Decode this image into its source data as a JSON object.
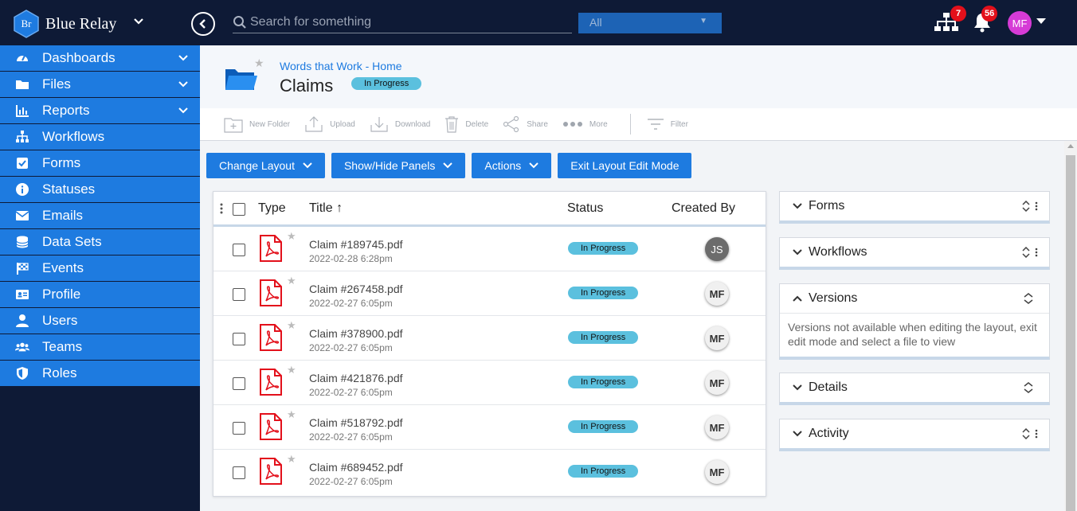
{
  "app": {
    "brand": "Blue Relay",
    "logo_text": "Br"
  },
  "topbar": {
    "search_placeholder": "Search for something",
    "scope_value": "All",
    "workflow_badge": "7",
    "notification_badge": "56",
    "user_initials": "MF",
    "colors": {
      "bg": "#0e1a36",
      "accent": "#1e7be0",
      "badge": "#e3101b",
      "avatar": "#d63bd6"
    }
  },
  "sidebar": {
    "items": [
      {
        "label": "Dashboards",
        "icon": "dashboard-icon",
        "expandable": true
      },
      {
        "label": "Files",
        "icon": "folder-icon",
        "expandable": true
      },
      {
        "label": "Reports",
        "icon": "bar-chart-icon",
        "expandable": true
      },
      {
        "label": "Workflows",
        "icon": "sitemap-icon",
        "expandable": false
      },
      {
        "label": "Forms",
        "icon": "checkbox-icon",
        "expandable": false
      },
      {
        "label": "Statuses",
        "icon": "info-icon",
        "expandable": false
      },
      {
        "label": "Emails",
        "icon": "envelope-icon",
        "expandable": false
      },
      {
        "label": "Data Sets",
        "icon": "database-icon",
        "expandable": false
      },
      {
        "label": "Events",
        "icon": "flag-checkered-icon",
        "expandable": false
      },
      {
        "label": "Profile",
        "icon": "id-card-icon",
        "expandable": false
      },
      {
        "label": "Users",
        "icon": "user-icon",
        "expandable": false
      },
      {
        "label": "Teams",
        "icon": "users-icon",
        "expandable": false
      },
      {
        "label": "Roles",
        "icon": "shield-icon",
        "expandable": false
      }
    ]
  },
  "header": {
    "breadcrumb": "Words that Work - Home",
    "title": "Claims",
    "status": "In Progress"
  },
  "toolbar": {
    "new_folder": "New Folder",
    "upload": "Upload",
    "download": "Download",
    "delete": "Delete",
    "share": "Share",
    "more": "More",
    "filter": "Filter"
  },
  "layout_buttons": {
    "change_layout": "Change Layout",
    "show_hide_panels": "Show/Hide Panels",
    "actions": "Actions",
    "exit_layout_edit": "Exit Layout Edit Mode"
  },
  "table": {
    "columns": {
      "type": "Type",
      "title": "Title",
      "sort_indicator": "↑",
      "status": "Status",
      "created_by": "Created By"
    },
    "rows": [
      {
        "name": "Claim #189745.pdf",
        "date": "2022-02-28 6:28pm",
        "status": "In Progress",
        "created_by": "JS"
      },
      {
        "name": "Claim #267458.pdf",
        "date": "2022-02-27 6:05pm",
        "status": "In Progress",
        "created_by": "MF"
      },
      {
        "name": "Claim #378900.pdf",
        "date": "2022-02-27 6:05pm",
        "status": "In Progress",
        "created_by": "MF"
      },
      {
        "name": "Claim #421876.pdf",
        "date": "2022-02-27 6:05pm",
        "status": "In Progress",
        "created_by": "MF"
      },
      {
        "name": "Claim #518792.pdf",
        "date": "2022-02-27 6:05pm",
        "status": "In Progress",
        "created_by": "MF"
      },
      {
        "name": "Claim #689452.pdf",
        "date": "2022-02-27 6:05pm",
        "status": "In Progress",
        "created_by": "MF"
      }
    ]
  },
  "panels": {
    "forms": "Forms",
    "workflows": "Workflows",
    "versions": "Versions",
    "versions_message": "Versions not available when editing the layout, exit edit mode and select a file to view",
    "details": "Details",
    "activity": "Activity"
  }
}
